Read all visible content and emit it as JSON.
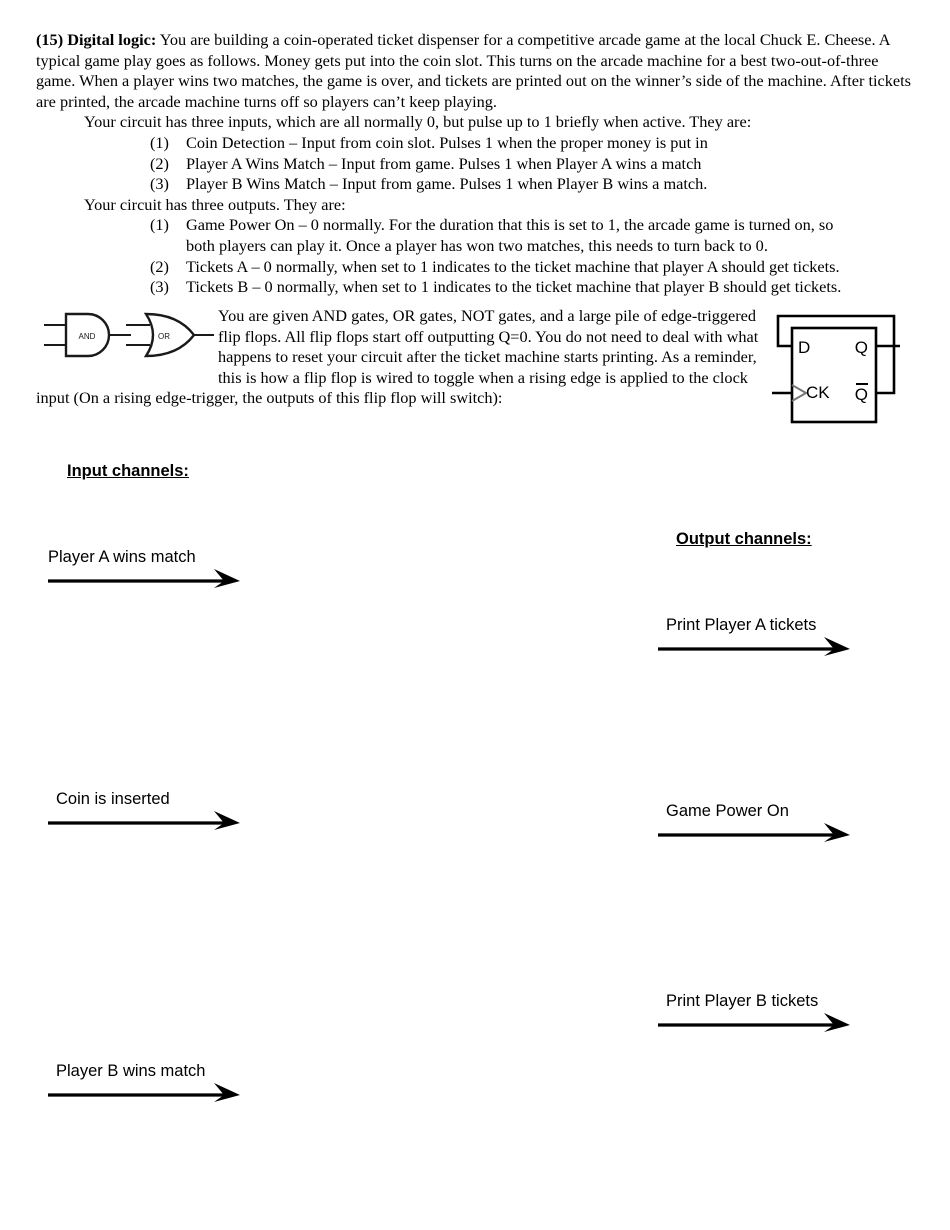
{
  "problem": {
    "number": "(15)",
    "topic": "Digital logic:",
    "intro": "You are building a coin-operated ticket dispenser for a competitive arcade game at the local Chuck E. Cheese. A typical game play goes as follows. Money gets put into the coin slot. This turns on the arcade machine for a best two-out-of-three game. When a player wins two matches, the game is over, and tickets are printed out on the winner’s side of the machine. After tickets are printed, the arcade machine turns off so players can’t keep playing.",
    "inputs_lead": "Your circuit has three inputs, which are all normally 0, but pulse up to 1 briefly when active. They are:",
    "inputs": [
      {
        "num": "(1)",
        "text": "Coin Detection – Input from coin slot.  Pulses 1 when the proper money is put in"
      },
      {
        "num": "(2)",
        "text": "Player A Wins Match – Input from game.  Pulses 1 when Player A wins a match"
      },
      {
        "num": "(3)",
        "text": "Player B Wins Match – Input from game.  Pulses 1 when Player B wins a match."
      }
    ],
    "outputs_lead": "Your circuit has three outputs.  They are:",
    "outputs": [
      {
        "num": "(1)",
        "text": "Game Power On – 0 normally.  For the duration that this is set to 1, the arcade game is turned on, so",
        "cont": "both players can play it.  Once a player has won two matches, this needs to turn back to 0."
      },
      {
        "num": "(2)",
        "text": "Tickets A – 0 normally, when set to 1 indicates to the ticket machine that player A should get tickets.",
        "cont": ""
      },
      {
        "num": "(3)",
        "text": "Tickets B – 0 normally, when set to 1 indicates to the ticket machine that player B should get tickets.",
        "cont": ""
      }
    ],
    "resources_para": "You are given AND gates, OR gates, NOT gates, and a large pile of edge-triggered flip flops.  All flip flops start off outputting Q=0.  You do not need to deal with what happens to reset your circuit after the ticket machine starts printing. As a reminder, this is how a flip flop is wired to toggle when a rising edge is applied to the clock input (On a rising edge-trigger, the outputs of this flip flop will switch):"
  },
  "gates": {
    "and_label": "AND",
    "or_label": "OR"
  },
  "flipflop": {
    "d_label": "D",
    "q_label": "Q",
    "ck_label": "CK",
    "qbar_label": "Q"
  },
  "worksheet": {
    "input_heading": "Input channels:",
    "output_heading": "Output channels:",
    "input_arrows": [
      {
        "label": "Player A wins match"
      },
      {
        "label": "Coin is inserted"
      },
      {
        "label": "Player B wins match"
      }
    ],
    "output_arrows": [
      {
        "label": "Print Player A tickets"
      },
      {
        "label": "Game Power On"
      },
      {
        "label": "Print Player B tickets"
      }
    ]
  },
  "colors": {
    "ink": "#000000",
    "paper": "#ffffff",
    "gate_stroke": "#1a1a1a"
  }
}
